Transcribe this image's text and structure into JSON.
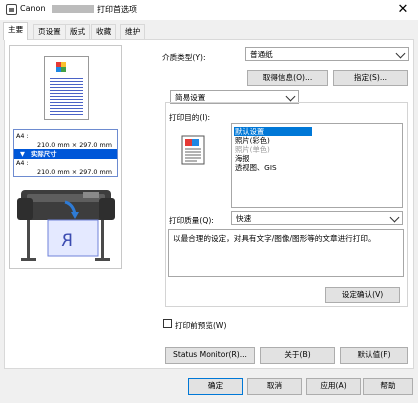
{
  "window": {
    "title_prefix": "Canon",
    "title_suffix": "打印首选项",
    "close_glyph": "✕"
  },
  "tabs": [
    {
      "label": "主要",
      "active": true
    },
    {
      "label": "页设置",
      "active": false
    },
    {
      "label": "版式",
      "active": false
    },
    {
      "label": "收藏",
      "active": false
    },
    {
      "label": "维护",
      "active": false
    }
  ],
  "preview": {
    "size_rows": [
      {
        "text": "A4 :"
      },
      {
        "text": "210.0 mm × 297.0 mm"
      },
      {
        "text": "实际尺寸"
      },
      {
        "text": "A4 :"
      },
      {
        "text": "210.0 mm × 297.0 mm"
      }
    ],
    "arrow_glyph": "▼"
  },
  "media": {
    "label": "介质类型(Y):",
    "value": "普通纸",
    "get_info_label": "取得信息(O)...",
    "specify_label": "指定(S)..."
  },
  "settings_mode": {
    "value": "简易设置"
  },
  "purpose": {
    "label": "打印目的(I):",
    "items": [
      {
        "text": "默认设置",
        "state": "selected"
      },
      {
        "text": "照片(彩色)",
        "state": "normal"
      },
      {
        "text": "照片(单色)",
        "state": "disabled"
      },
      {
        "text": "海报",
        "state": "normal"
      },
      {
        "text": "透视图、GIS",
        "state": "normal"
      }
    ]
  },
  "quality": {
    "label": "打印质量(Q):",
    "value": "快速"
  },
  "description": "以最合理的设定，对具有文字/图像/图形等的文章进行打印。",
  "confirm_settings_label": "设定确认(V)",
  "preview_before_print": {
    "label": "打印前预览(W)",
    "checked": false
  },
  "footer_buttons": {
    "status_monitor": "Status Monitor(R)...",
    "about": "关于(B)",
    "defaults": "默认值(F)"
  },
  "dialog_buttons": {
    "ok": "确定",
    "cancel": "取消",
    "apply": "应用(A)",
    "help": "帮助"
  },
  "colors": {
    "selection": "#0078d7",
    "highlight": "#0057d8",
    "default_button_border": "#0078d7"
  }
}
